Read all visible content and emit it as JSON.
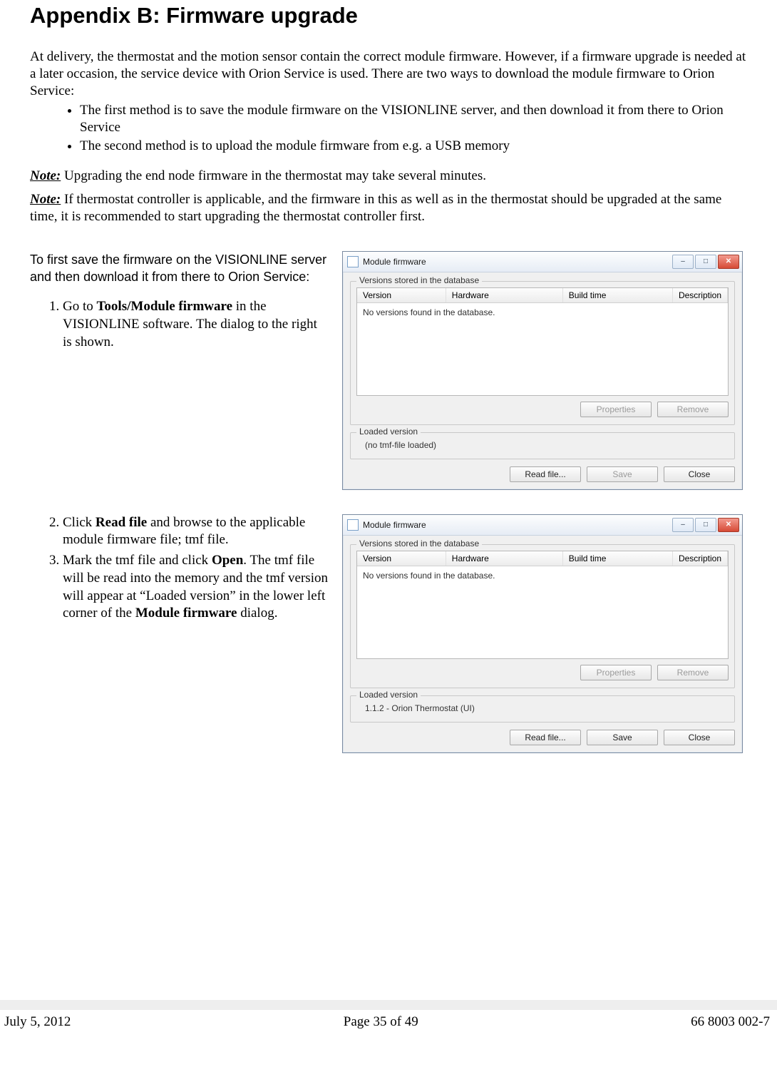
{
  "title": "Appendix B: Firmware upgrade",
  "intro": "At delivery, the thermostat and the motion sensor contain the correct module firmware. However, if a firmware upgrade is needed at a later occasion, the service device with Orion Service is used. There are two ways to download the module firmware to Orion Service:",
  "bullets": [
    "The first method is to save the module firmware on the VISIONLINE server, and then download it from there to Orion Service",
    "The second method is to upload the module firmware from e.g. a USB memory"
  ],
  "note_label": "Note:",
  "note1_text": " Upgrading the end node firmware in the thermostat may take several minutes.",
  "note2_text": " If thermostat controller is applicable, and the firmware in this as well as in the thermostat should be upgraded at the same time, it is recommended to start upgrading the thermostat controller first.",
  "section1": {
    "lead": "To first save the firmware on the VISIONLINE server and then download it from there to Orion Service:",
    "step1_pre": "Go to ",
    "step1_bold": "Tools/Module firmware",
    "step1_post": " in the VISIONLINE software. The dialog to the right is shown."
  },
  "section2": {
    "step2_pre": "Click ",
    "step2_bold": "Read file",
    "step2_post": " and browse to the applicable module firmware file; tmf file.",
    "step3_pre": "Mark the tmf file and click ",
    "step3_bold": "Open",
    "step3_mid": ". The tmf file will be read into the memory and the tmf version will appear at “Loaded version” in the lower left corner of the ",
    "step3_bold2": "Module firmware",
    "step3_post": " dialog."
  },
  "dialog": {
    "title": "Module firmware",
    "group_stored": "Versions stored in the database",
    "col_version": "Version",
    "col_hardware": "Hardware",
    "col_build": "Build time",
    "col_desc": "Description",
    "empty_msg": "No versions found in the database.",
    "btn_properties": "Properties",
    "btn_remove": "Remove",
    "group_loaded": "Loaded version",
    "loaded_none": "(no tmf-file loaded)",
    "loaded_value": "1.1.2 - Orion Thermostat (UI)",
    "btn_readfile": "Read file...",
    "btn_save": "Save",
    "btn_close": "Close",
    "win_min": "–",
    "win_max": "□",
    "win_close": "✕"
  },
  "footer": {
    "date": "July 5, 2012",
    "page": "Page 35 of 49",
    "docnum": "66 8003 002-7"
  }
}
